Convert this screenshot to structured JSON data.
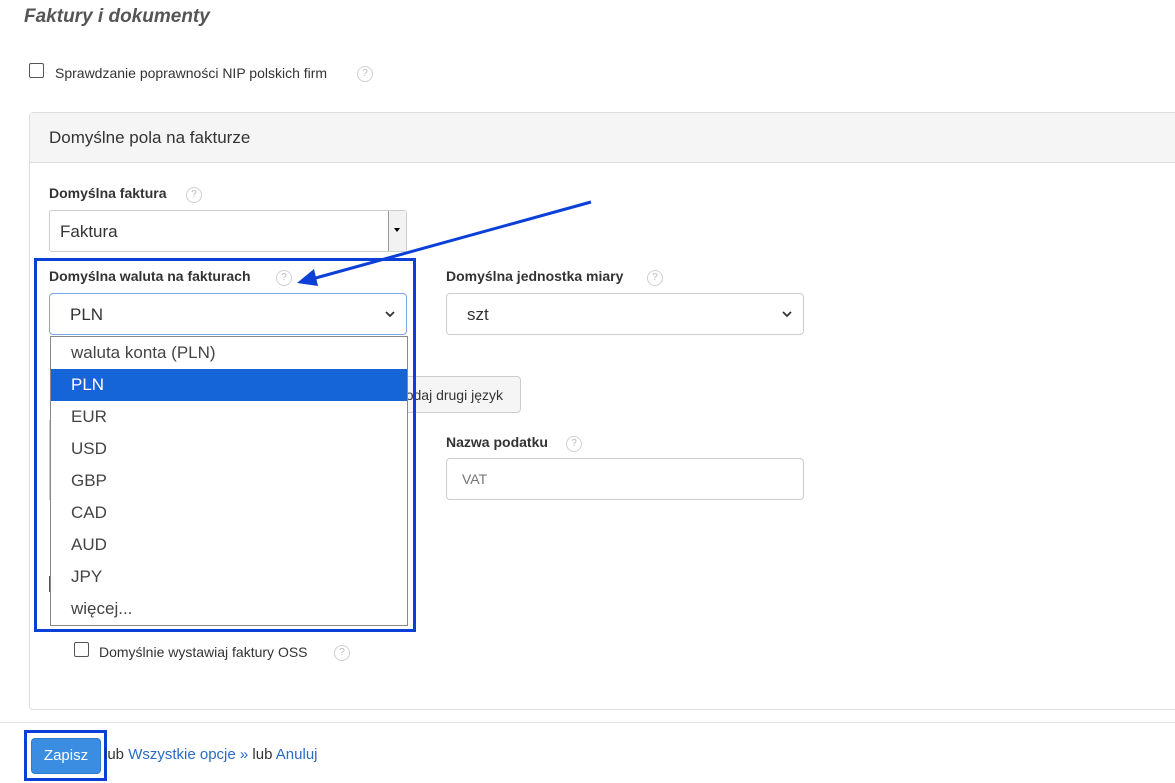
{
  "page": {
    "title": "Faktury i dokumenty",
    "nip_check_label": "Sprawdzanie poprawności NIP polskich firm"
  },
  "panel": {
    "title": "Domyślne pola na fakturze"
  },
  "fields": {
    "default_invoice": {
      "label": "Domyślna faktura",
      "value": "Faktura"
    },
    "default_currency": {
      "label": "Domyślna waluta na fakturach",
      "value": "PLN"
    },
    "default_unit": {
      "label": "Domyślna jednostka miary",
      "value": "szt"
    },
    "second_language_button": "odaj drugi język",
    "tax_name": {
      "label": "Nazwa podatku",
      "placeholder": "VAT"
    },
    "oss_label": "Domyślnie wystawiaj faktury OSS"
  },
  "currency_dropdown": {
    "options": [
      "waluta konta (PLN)",
      "PLN",
      "EUR",
      "USD",
      "GBP",
      "CAD",
      "AUD",
      "JPY",
      "więcej..."
    ],
    "selected_index": 1
  },
  "footer": {
    "save_label": "Zapisz",
    "or_1": "lub",
    "all_options_link": "Wszystkie opcje »",
    "or_2": "lub",
    "cancel_link": "Anuluj"
  },
  "colors": {
    "highlight": "#0a3fd8",
    "selected_option": "#1565d8",
    "save_button": "#3a8de0"
  }
}
